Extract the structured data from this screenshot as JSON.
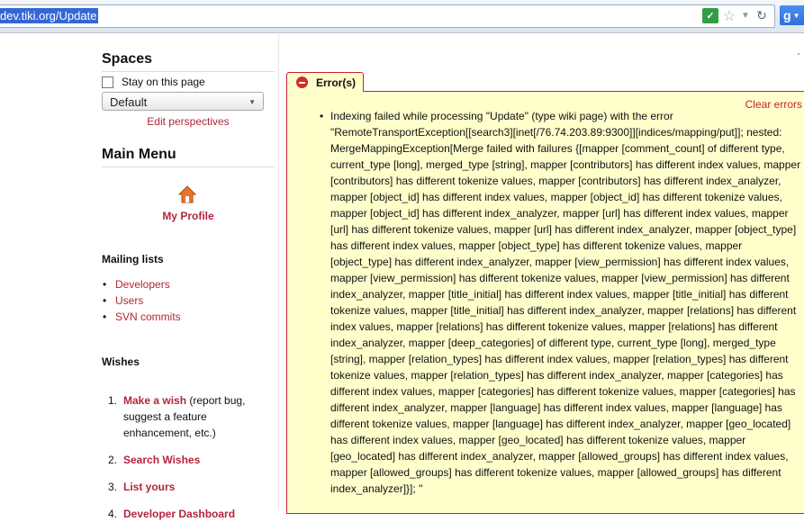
{
  "browser": {
    "url": "dev.tiki.org/Update",
    "search_engine_label": "g"
  },
  "sidebar": {
    "spaces_title": "Spaces",
    "stay_label": "Stay on this page",
    "perspective_value": "Default",
    "edit_perspectives": "Edit perspectives",
    "main_menu_title": "Main Menu",
    "my_profile": "My Profile",
    "mailing_lists_title": "Mailing lists",
    "mailing_lists": [
      "Developers",
      "Users",
      "SVN commits"
    ],
    "wishes_title": "Wishes",
    "wishes": [
      {
        "num": "1.",
        "link": "Make a wish",
        "desc": " (report bug, suggest a feature enhancement, etc.)"
      },
      {
        "num": "2.",
        "link": "Search Wishes",
        "desc": ""
      },
      {
        "num": "3.",
        "link": "List yours",
        "desc": ""
      },
      {
        "num": "4.",
        "link": "Developer Dashboard",
        "desc": ""
      }
    ]
  },
  "error": {
    "tab_label": "Error(s)",
    "clear_label": "Clear errors",
    "message": "Indexing failed while processing \"Update\" (type wiki page) with the error \"RemoteTransportException[[search3][inet[/76.74.203.89:9300]][indices/mapping/put]]; nested: MergeMappingException[Merge failed with failures {[mapper [comment_count] of different type, current_type [long], merged_type [string], mapper [contributors] has different index values, mapper [contributors] has different tokenize values, mapper [contributors] has different index_analyzer, mapper [object_id] has different index values, mapper [object_id] has different tokenize values, mapper [object_id] has different index_analyzer, mapper [url] has different index values, mapper [url] has different tokenize values, mapper [url] has different index_analyzer, mapper [object_type] has different index values, mapper [object_type] has different tokenize values, mapper [object_type] has different index_analyzer, mapper [view_permission] has different index values, mapper [view_permission] has different tokenize values, mapper [view_permission] has different index_analyzer, mapper [title_initial] has different index values, mapper [title_initial] has different tokenize values, mapper [title_initial] has different index_analyzer, mapper [relations] has different index values, mapper [relations] has different tokenize values, mapper [relations] has different index_analyzer, mapper [deep_categories] of different type, current_type [long], merged_type [string], mapper [relation_types] has different index values, mapper [relation_types] has different tokenize values, mapper [relation_types] has different index_analyzer, mapper [categories] has different index values, mapper [categories] has different tokenize values, mapper [categories] has different index_analyzer, mapper [language] has different index values, mapper [language] has different tokenize values, mapper [language] has different index_analyzer, mapper [geo_located] has different index values, mapper [geo_located] has different tokenize values, mapper [geo_located] has different index_analyzer, mapper [allowed_groups] has different index values, mapper [allowed_groups] has different tokenize values, mapper [allowed_groups] has different index_analyzer]}]; \""
  },
  "colors": {
    "link": "#b3263b",
    "error_border": "#c8202f",
    "error_bg": "#ffffcc",
    "url_highlight": "#3367d6"
  }
}
